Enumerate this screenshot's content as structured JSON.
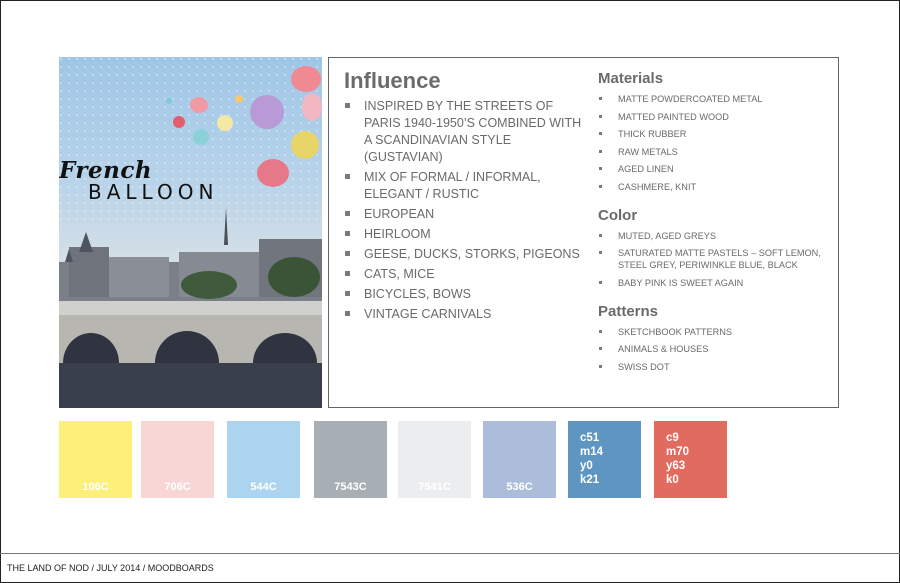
{
  "hero": {
    "script_title": "French",
    "main_title": "BALLOON"
  },
  "influence": {
    "heading": "Influence",
    "items": [
      "INSPIRED BY THE STREETS OF PARIS  1940-1950’S COMBINED WITH A SCANDINAVIAN STYLE (GUSTAVIAN)",
      "MIX OF FORMAL / INFORMAL, ELEGANT / RUSTIC",
      "EUROPEAN",
      "HEIRLOOM",
      "GEESE, DUCKS, STORKS, PIGEONS",
      "CATS, MICE",
      "BICYCLES, BOWS",
      "VINTAGE CARNIVALS"
    ]
  },
  "materials": {
    "heading": "Materials",
    "items": [
      "MATTE POWDERCOATED METAL",
      "MATTED PAINTED WOOD",
      "THICK RUBBER",
      "RAW METALS",
      "AGED LINEN",
      "CASHMERE, KNIT"
    ]
  },
  "color": {
    "heading": "Color",
    "items": [
      "MUTED, AGED GREYS",
      "SATURATED MATTE PASTELS – SOFT LEMON, STEEL GREY, PERIWINKLE BLUE, BLACK",
      "BABY PINK IS SWEET AGAIN"
    ]
  },
  "patterns": {
    "heading": "Patterns",
    "items": [
      "SKETCHBOOK PATTERNS",
      "ANIMALS & HOUSES",
      "SWISS DOT"
    ]
  },
  "swatches": [
    {
      "code": "106C",
      "color": "#fdf07a"
    },
    {
      "code": "706C",
      "color": "#f9d6d6"
    },
    {
      "code": "544C",
      "color": "#acd3ef"
    },
    {
      "code": "7543C",
      "color": "#a7aeb4"
    },
    {
      "code": "7541C",
      "color": "#ecedef"
    },
    {
      "code": "536C",
      "color": "#abbdda"
    }
  ],
  "cmyk_swatches": [
    {
      "c": "c51",
      "m": "m14",
      "y": "y0",
      "k": "k21",
      "color": "#5e96c1"
    },
    {
      "c": "c9",
      "m": "m70",
      "y": "y63",
      "k": "k0",
      "color": "#e26b5f"
    }
  ],
  "footer": {
    "text": "THE LAND OF NOD / JULY 2014 / MOODBOARDS"
  }
}
